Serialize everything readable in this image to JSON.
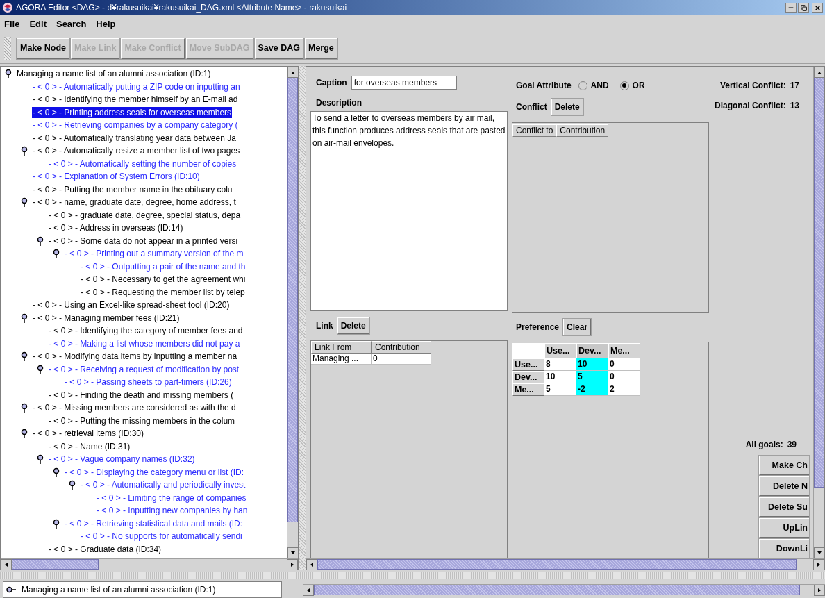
{
  "window": {
    "title": "AGORA Editor <DAG> - d¥rakusuikai¥rakusuikai_DAG.xml <Attribute Name> - rakusuikai"
  },
  "menu": [
    "File",
    "Edit",
    "Search",
    "Help"
  ],
  "toolbar": [
    {
      "label": "Make Node",
      "disabled": false
    },
    {
      "label": "Make Link",
      "disabled": true
    },
    {
      "label": "Make Conflict",
      "disabled": true
    },
    {
      "label": "Move SubDAG",
      "disabled": true
    },
    {
      "label": "Save DAG",
      "disabled": false
    },
    {
      "label": "Merge",
      "disabled": false
    }
  ],
  "tree": {
    "text": "Managing a name list of an alumni association (ID:1)",
    "color": "#000000",
    "selected": false,
    "children": [
      {
        "text": "- < 0 > - Automatically putting a ZIP code on inputting an",
        "color": "#2a2aff",
        "selected": false
      },
      {
        "text": "- < 0 > - Identifying the member himself by an E-mail ad",
        "color": "#000000",
        "selected": false
      },
      {
        "text": "- < 0 > - Printing address seals for overseas members",
        "selected": true
      },
      {
        "text": "- < 0 > - Retrieving companies by a company category (",
        "color": "#2a2aff",
        "selected": false
      },
      {
        "text": "- < 0 > - Automatically translating year data between Ja",
        "color": "#000000",
        "selected": false
      },
      {
        "text": "- < 0 > - Automatically resize a member list of two pages",
        "color": "#000000",
        "selected": false,
        "children": [
          {
            "text": "- < 0 > - Automatically setting the number of copies",
            "color": "#2a2aff",
            "selected": false
          }
        ]
      },
      {
        "text": "- < 0 > - Explanation of System Errors (ID:10)",
        "color": "#2a2aff",
        "selected": false
      },
      {
        "text": "- < 0 > - Putting the member name in the obituary colu",
        "color": "#000000",
        "selected": false
      },
      {
        "text": "- < 0 > - name, graduate date, degree, home address, t",
        "color": "#000000",
        "selected": false,
        "children": [
          {
            "text": "- < 0 > - graduate date, degree, special status, depa",
            "color": "#000000",
            "selected": false
          },
          {
            "text": "- < 0 > - Address in overseas (ID:14)",
            "color": "#000000",
            "selected": false
          },
          {
            "text": "- < 0 > - Some data do not appear in a printed versi",
            "color": "#000000",
            "selected": false,
            "children": [
              {
                "text": "- < 0 > - Printing out a summary version of the m",
                "color": "#2a2aff",
                "selected": false,
                "children": [
                  {
                    "text": "- < 0 > - Outputting a pair of the name and th",
                    "color": "#2a2aff",
                    "selected": false
                  },
                  {
                    "text": "- < 0 > - Necessary to get the agreement whi",
                    "color": "#000000",
                    "selected": false
                  },
                  {
                    "text": "- < 0 > - Requesting the member list by telep",
                    "color": "#000000",
                    "selected": false
                  }
                ]
              }
            ]
          }
        ]
      },
      {
        "text": "- < 0 > - Using an Excel-like spread-sheet tool (ID:20)",
        "color": "#000000",
        "selected": false
      },
      {
        "text": "- < 0 > - Managing member fees (ID:21)",
        "color": "#000000",
        "selected": false,
        "children": [
          {
            "text": "- < 0 > - Identifying the category of member fees and",
            "color": "#000000",
            "selected": false
          },
          {
            "text": "- < 0 > - Making a list whose members did not pay a",
            "color": "#2a2aff",
            "selected": false
          }
        ]
      },
      {
        "text": "- < 0 > - Modifying data items by inputting a member na",
        "color": "#000000",
        "selected": false,
        "children": [
          {
            "text": "- < 0 > - Receiving a request of modification by post",
            "color": "#2a2aff",
            "selected": false,
            "children": [
              {
                "text": "- < 0 > - Passing sheets to part-timers (ID:26)",
                "color": "#2a2aff",
                "selected": false
              }
            ]
          },
          {
            "text": "- < 0 > - Finding the death and missing members (",
            "color": "#000000",
            "selected": false
          }
        ]
      },
      {
        "text": "- < 0 > - Missing members are considered as with the d",
        "color": "#000000",
        "selected": false,
        "children": [
          {
            "text": "- < 0 > - Putting the missing members in the colum",
            "color": "#000000",
            "selected": false
          }
        ]
      },
      {
        "text": "- < 0 > - retrieval items (ID:30)",
        "color": "#000000",
        "selected": false,
        "children": [
          {
            "text": "- < 0 > - Name (ID:31)",
            "color": "#000000",
            "selected": false
          },
          {
            "text": "- < 0 > - Vague company names (ID:32)",
            "color": "#2a2aff",
            "selected": false,
            "children": [
              {
                "text": "- < 0 > - Displaying the category menu or list (ID:",
                "color": "#2a2aff",
                "selected": false,
                "children": [
                  {
                    "text": "- < 0 > - Automatically and periodically invest",
                    "color": "#2a2aff",
                    "selected": false,
                    "children": [
                      {
                        "text": "- < 0 > - Limiting the range of companies",
                        "color": "#2a2aff",
                        "selected": false
                      },
                      {
                        "text": "- < 0 > - Inputting new companies by han",
                        "color": "#2a2aff",
                        "selected": false
                      }
                    ]
                  }
                ]
              },
              {
                "text": "- < 0 > - Retrieving statistical data and mails (ID:",
                "color": "#2a2aff",
                "selected": false,
                "children": [
                  {
                    "text": "- < 0 > - No supports for automatically sendi",
                    "color": "#2a2aff",
                    "selected": false
                  }
                ]
              }
            ]
          },
          {
            "text": "- < 0 > - Graduate data (ID:34)",
            "color": "#000000",
            "selected": false
          }
        ]
      }
    ]
  },
  "caption": {
    "label": "Caption",
    "value": "for overseas members"
  },
  "description": {
    "label": "Description",
    "value": "To send a letter to overseas members by air mail, this function produces address seals that are pasted on air-mail envelopes."
  },
  "goal_attribute": {
    "label": "Goal Attribute",
    "options": [
      {
        "label": "AND",
        "selected": false
      },
      {
        "label": "OR",
        "selected": true
      }
    ]
  },
  "conflict": {
    "label": "Conflict",
    "button": "Delete",
    "columns": [
      "Conflict to",
      "Contribution"
    ]
  },
  "link": {
    "label": "Link",
    "button": "Delete",
    "columns": [
      "Link From",
      "Contribution"
    ],
    "rows": [
      [
        "Managing ...",
        "0"
      ]
    ]
  },
  "preference": {
    "label": "Preference",
    "button": "Clear",
    "columns": [
      {
        "label": "Use...",
        "selected": false
      },
      {
        "label": "Dev...",
        "selected": true
      },
      {
        "label": "Me...",
        "selected": false
      }
    ],
    "rows": [
      {
        "label": "Use...",
        "cells": [
          "8",
          "10",
          "0"
        ]
      },
      {
        "label": "Dev...",
        "cells": [
          "10",
          "5",
          "0"
        ]
      },
      {
        "label": "Me...",
        "cells": [
          "5",
          "-2",
          "2"
        ]
      }
    ]
  },
  "stats": [
    {
      "label": "Vertical Conflict:",
      "value": "17"
    },
    {
      "label": "Diagonal Conflict:",
      "value": "13"
    }
  ],
  "all_goals": {
    "label": "All goals:",
    "value": "39"
  },
  "actions": [
    "Make Ch",
    "Delete N",
    "Delete Su",
    "UpLin",
    "DownLi"
  ],
  "status": {
    "text": "Managing a name list of an alumni association (ID:1)"
  }
}
